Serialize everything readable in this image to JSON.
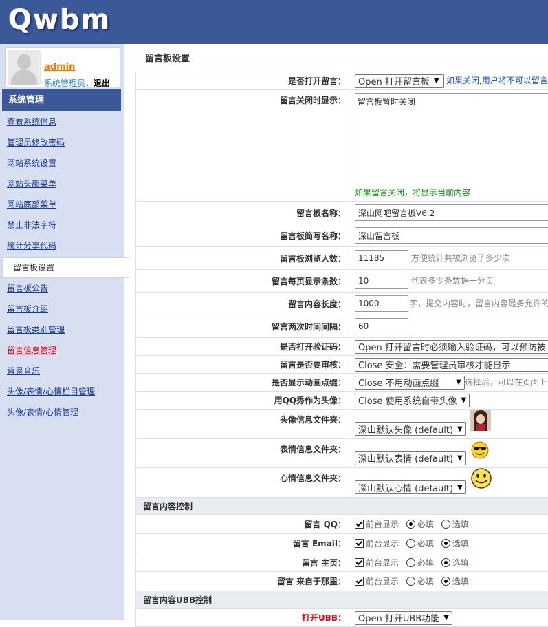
{
  "header": {
    "logo": "Qwbm",
    "bg_color": "#3b5998"
  },
  "user": {
    "name": "admin",
    "role": "系统管理员",
    "separator": "，",
    "logout": "退出"
  },
  "nav": {
    "heading": "系统管理",
    "items": [
      {
        "label": "查看系统信息"
      },
      {
        "label": "管理员修改密码"
      },
      {
        "label": "网站系统设置"
      },
      {
        "label": "网站头部菜单"
      },
      {
        "label": "网站底部菜单"
      },
      {
        "label": "禁止非法字符"
      },
      {
        "label": "统计分享代码"
      },
      {
        "label": "留言板设置"
      },
      {
        "label": "留言板公告"
      },
      {
        "label": "留言板介绍"
      },
      {
        "label": "留言板类别管理"
      },
      {
        "label": "留言信息管理"
      },
      {
        "label": "背景音乐"
      },
      {
        "label": "头像/表情/心情栏目管理"
      },
      {
        "label": "头像/表情/心情管理"
      }
    ]
  },
  "main": {
    "title": "留言板设置",
    "rows": {
      "open": {
        "label": "是否打开留言：",
        "value": "Open 打开留言板",
        "hint": "如果关闭,用户将不可以留言"
      },
      "closed_msg": {
        "label": "留言关闭时显示：",
        "value": "留言板暂时关闭",
        "hint": "如果留言关闭，将显示当前内容"
      },
      "board_name": {
        "label": "留言板名称：",
        "value": "深山网吧留言板V6.2"
      },
      "short_name": {
        "label": "留言板简写名称：",
        "value": "深山留言板"
      },
      "views": {
        "label": "留言板浏览人数：",
        "value": "11185",
        "hint": "方便统计共被浏览了多少次"
      },
      "per_page": {
        "label": "留言每页显示条数：",
        "value": "10",
        "hint": "代表多少条数据一分页"
      },
      "content_len": {
        "label": "留言内容长度：",
        "value": "1000",
        "hint": "字，提交内容时，留言内容最多允许的"
      },
      "interval": {
        "label": "留言两次时间间隔：",
        "value": "60"
      },
      "captcha": {
        "label": "是否打开验证码：",
        "value": "Open 打开留言时必须输入验证码，可以预防被"
      },
      "review": {
        "label": "留言是否要审核：",
        "value": "Close 安全：需要管理员审核才能显示"
      },
      "animation": {
        "label": "是否显示动画点缀：",
        "value": "Close 不用动画点缀",
        "hint": "选择后，可以在页面上"
      },
      "qq_avatar": {
        "label": "用QQ秀作为头像：",
        "value": "Close 使用系统自带头像"
      },
      "avatar_dir": {
        "label": "头像信息文件夹：",
        "value": "深山默认头像 (default)"
      },
      "emotion_dir": {
        "label": "表情信息文件夹：",
        "value": "深山默认表情 (default)"
      },
      "mood_dir": {
        "label": "心情信息文件夹：",
        "value": "深山默认心情 (default)"
      }
    },
    "section_content": "留言内容控制",
    "fields": [
      {
        "label": "留言 QQ：",
        "show": "前台显示",
        "required": "必填",
        "optional": "选填",
        "selected": "required"
      },
      {
        "label": "留言 Email：",
        "show": "前台显示",
        "required": "必填",
        "optional": "选填",
        "selected": "optional"
      },
      {
        "label": "留言 主页：",
        "show": "前台显示",
        "required": "必填",
        "optional": "选填",
        "selected": "optional"
      },
      {
        "label": "留言 来自于那里：",
        "show": "前台显示",
        "required": "必填",
        "optional": "选填",
        "selected": "optional"
      }
    ],
    "section_ubb": "留言内容UBB控制",
    "ubb": {
      "label": "打开UBB：",
      "value": "Open 打开UBB功能"
    }
  }
}
